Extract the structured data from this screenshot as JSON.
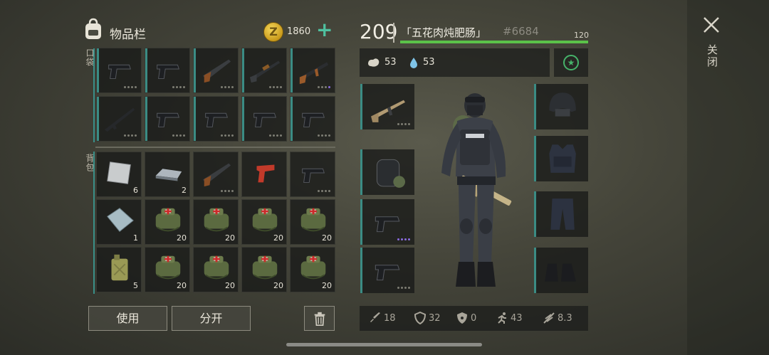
{
  "header": {
    "title": "物品栏",
    "coins": "1860",
    "coin_symbol": "Z",
    "add": "+"
  },
  "sections": {
    "pocket": "口袋",
    "backpack": "背包"
  },
  "pocket_items": [
    {
      "name": "pistol"
    },
    {
      "name": "pistol"
    },
    {
      "name": "shotgun"
    },
    {
      "name": "pump-shotgun"
    },
    {
      "name": "assault-rifle"
    },
    {
      "name": "rifle"
    },
    {
      "name": "pistol"
    },
    {
      "name": "pistol"
    },
    {
      "name": "pistol"
    },
    {
      "name": "pistol"
    }
  ],
  "backpack_items": [
    {
      "name": "steel-plate",
      "qty": "6"
    },
    {
      "name": "iron-ingot",
      "qty": "2"
    },
    {
      "name": "shotgun",
      "qty": ""
    },
    {
      "name": "flare-gun",
      "qty": ""
    },
    {
      "name": "pistol",
      "qty": ""
    },
    {
      "name": "glass-sheet",
      "qty": "1"
    },
    {
      "name": "medkit",
      "qty": "20"
    },
    {
      "name": "medkit",
      "qty": "20"
    },
    {
      "name": "medkit",
      "qty": "20"
    },
    {
      "name": "medkit",
      "qty": "20"
    },
    {
      "name": "jerrycan",
      "qty": "5"
    },
    {
      "name": "medkit",
      "qty": "20"
    },
    {
      "name": "medkit",
      "qty": "20"
    },
    {
      "name": "medkit",
      "qty": "20"
    },
    {
      "name": "medkit",
      "qty": "20"
    }
  ],
  "buttons": {
    "use": "使用",
    "split": "分开"
  },
  "player": {
    "level": "209",
    "name": "「五花肉炖肥肠」",
    "id": "#6684",
    "xp_value": "120",
    "xp_fraction": 1.0,
    "food": "53",
    "water": "53"
  },
  "gear_left": [
    {
      "name": "assault-rifle-tan"
    },
    {
      "name": "backpack"
    },
    {
      "name": "pistol"
    },
    {
      "name": "pistol"
    }
  ],
  "gear_right": [
    {
      "name": "helmet"
    },
    {
      "name": "body-armor"
    },
    {
      "name": "pants"
    },
    {
      "name": "boots"
    }
  ],
  "stats": {
    "attack": "18",
    "defense": "32",
    "radiation": "0",
    "speed": "43",
    "stealth": "8.3"
  },
  "close_label": "关闭",
  "colors": {
    "accent_teal": "#3b8c84",
    "xp_green": "#5bc249",
    "plus_green": "#4fc1a0",
    "rarity_purple": "#8a6be0"
  }
}
